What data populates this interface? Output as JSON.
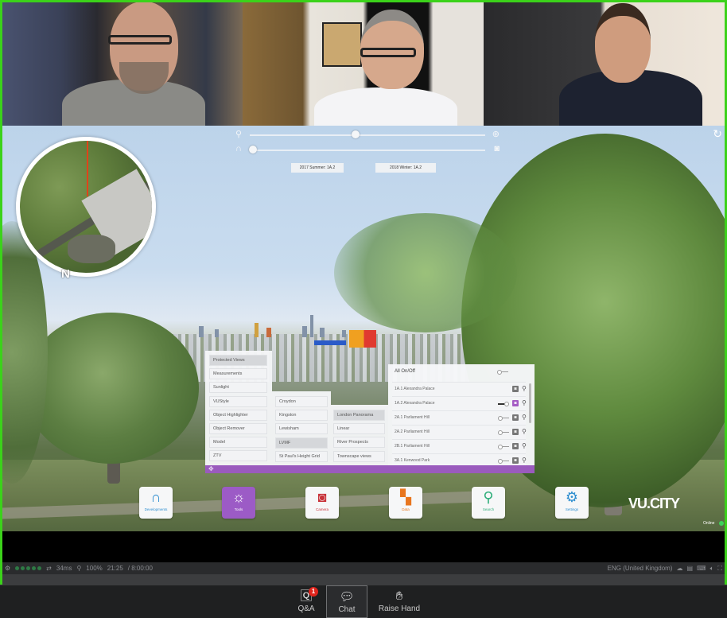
{
  "participants": [
    {
      "id": "participant-1",
      "active_speaker": true
    },
    {
      "id": "participant-2",
      "active_speaker": false
    },
    {
      "id": "participant-3",
      "active_speaker": false
    }
  ],
  "colors": {
    "active_speaker_border": "#3bd21a",
    "accent_purple": "#9c5bc6",
    "online_green": "#3ed15a",
    "badge_red": "#e0241c"
  },
  "app": {
    "brand": "VU.CITY",
    "minimap": {
      "north_label": "N"
    },
    "sliders": {
      "zoom": {
        "value_fraction": 0.45
      },
      "time": {
        "value_fraction": 0.0
      }
    },
    "date_chips": [
      "2017 Summer: 1A.2",
      "2018 Winter: 1A.2"
    ],
    "tools_menu": {
      "col1": [
        "Protected Views",
        "Measurements",
        "Sunlight",
        "VUStyle",
        "Object Highlighter",
        "Object Remover",
        "Model",
        "ZTV"
      ],
      "col1_active": "Protected Views",
      "col2": [
        "Croydon",
        "Kingston",
        "Lewisham",
        "LVMF",
        "St Paul's Height Grid"
      ],
      "col2_active": "LVMF",
      "col3": [
        "London Panorama",
        "Linear",
        "River Prospects",
        "Townscape views"
      ],
      "col3_active": "London Panorama"
    },
    "protected_views": {
      "all_label": "All On/Off",
      "rows": [
        {
          "label": "1A.1 Alexandra Palace",
          "on": false,
          "has_toggle": false,
          "camera_active": false
        },
        {
          "label": "1A.2 Alexandra Palace",
          "on": true,
          "has_toggle": true,
          "camera_active": true
        },
        {
          "label": "2A.1 Parliament Hill",
          "on": false,
          "has_toggle": true,
          "camera_active": false
        },
        {
          "label": "2A.2 Parliament Hill",
          "on": false,
          "has_toggle": true,
          "camera_active": false
        },
        {
          "label": "2B.1 Parliament Hill",
          "on": false,
          "has_toggle": true,
          "camera_active": false
        },
        {
          "label": "3A.1 Kenwood Park",
          "on": false,
          "has_toggle": true,
          "camera_active": false
        }
      ]
    },
    "toolbar": [
      {
        "label": "Developments",
        "icon": "developments-icon",
        "glyph": "∩",
        "color": "#2f8fd0",
        "active": false
      },
      {
        "label": "Tools",
        "icon": "sun-icon",
        "glyph": "☼",
        "color": "#ffffff",
        "active": true
      },
      {
        "label": "Camera",
        "icon": "camera-icon",
        "glyph": "◙",
        "color": "#c8333a",
        "active": false
      },
      {
        "label": "Data",
        "icon": "data-icon",
        "glyph": "▚",
        "color": "#e8761e",
        "active": false
      },
      {
        "label": "Search",
        "icon": "search-icon",
        "glyph": "⚲",
        "color": "#2fae7a",
        "active": false
      },
      {
        "label": "Settings",
        "icon": "settings-icon",
        "glyph": "⚙",
        "color": "#2f8fd0",
        "active": false
      }
    ],
    "online_label": "Online"
  },
  "statusbar": {
    "ping": "34ms",
    "zoom": "100%",
    "time": "21:25",
    "duration": "/ 8:00:00",
    "signal_dots": 5,
    "language": "ENG (United Kingdom)"
  },
  "zoom_controls": {
    "qa": {
      "label": "Q&A",
      "badge": "1"
    },
    "chat": {
      "label": "Chat",
      "selected": true
    },
    "raise_hand": {
      "label": "Raise Hand"
    }
  }
}
